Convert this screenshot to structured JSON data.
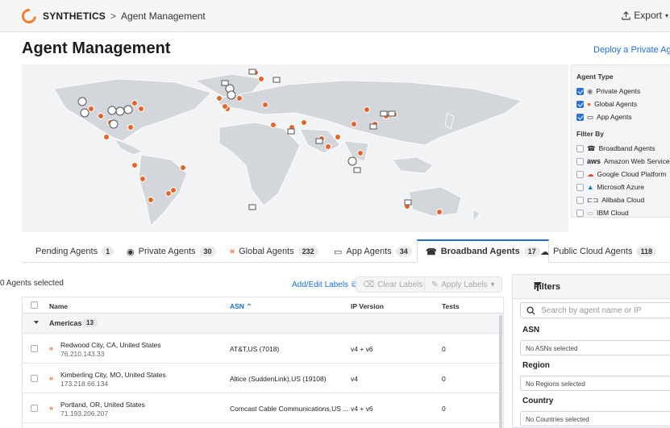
{
  "header": {
    "brand": "SYNTHETICS",
    "breadcrumb_sep": ">",
    "breadcrumb": "Agent Management",
    "export_label": "Export",
    "export_icon": "export-icon"
  },
  "page": {
    "title": "Agent Management",
    "deploy_link": "Deploy a Private Agent"
  },
  "legend": {
    "agent_type_title": "Agent Type",
    "agent_types": [
      {
        "label": "Private Agents",
        "checked": true
      },
      {
        "label": "Global Agents",
        "checked": true
      },
      {
        "label": "App Agents",
        "checked": true
      }
    ],
    "filter_by_title": "Filter By",
    "filters": [
      {
        "label": "Broadband Agents"
      },
      {
        "label": "Amazon Web Services",
        "logo": "aws"
      },
      {
        "label": "Google Cloud Platform"
      },
      {
        "label": "Microsoft Azure"
      },
      {
        "label": "Alibaba Cloud"
      },
      {
        "label": "IBM Cloud"
      }
    ]
  },
  "tabs": [
    {
      "label": "Pending Agents",
      "count": "1"
    },
    {
      "label": "Private Agents",
      "count": "30"
    },
    {
      "label": "Global Agents",
      "count": "232"
    },
    {
      "label": "App Agents",
      "count": "34"
    },
    {
      "label": "Broadband Agents",
      "count": "17",
      "active": true
    },
    {
      "label": "Public Cloud Agents",
      "count": "118"
    }
  ],
  "toolbar": {
    "selected": "0 Agents selected",
    "add_edit": "Add/Edit Labels",
    "clear": "Clear Labels",
    "apply": "Apply Labels"
  },
  "table": {
    "columns": {
      "name": "Name",
      "asn": "ASN",
      "ip_version": "IP Version",
      "tests": "Tests"
    },
    "group": {
      "label": "Americas",
      "count": "13"
    },
    "rows": [
      {
        "name": "Redwood City, CA, United States",
        "ip": "76.210.143.33",
        "asn": "AT&T,US (7018)",
        "ipv": "v4 + v6",
        "tests": "0"
      },
      {
        "name": "Kimberling City, MO, United States",
        "ip": "173.218.66.134",
        "asn": "Altice (SuddenLink),US (19108)",
        "ipv": "v4",
        "tests": "0"
      },
      {
        "name": "Portland, OR, United States",
        "ip": "71.193.206.207",
        "asn": "Comcast Cable Communications,US ...",
        "ipv": "v4 + v6",
        "tests": "0"
      }
    ]
  },
  "filters": {
    "title": "Filters",
    "search_placeholder": "Search by agent name or IP",
    "asn_label": "ASN",
    "asn_value": "No ASNs selected",
    "region_label": "Region",
    "region_value": "No Regions selected",
    "country_label": "Country",
    "country_value": "No Countries selected"
  },
  "colors": {
    "accent": "#1f6fd1",
    "agent_marker": "#e2662a"
  }
}
